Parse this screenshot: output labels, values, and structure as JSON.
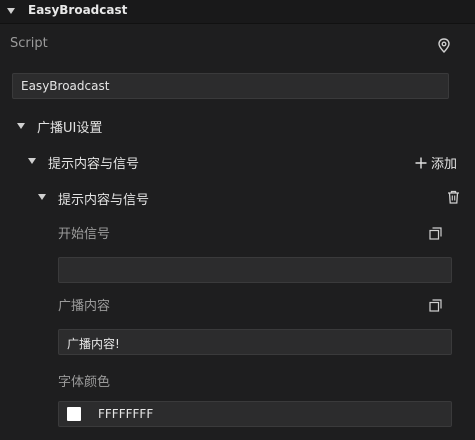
{
  "component": {
    "title": "EasyBroadcast"
  },
  "script": {
    "label": "Script",
    "value": "EasyBroadcast",
    "locate_icon": "location-pin-icon"
  },
  "broadcast_ui": {
    "label": "广播UI设置"
  },
  "prompt_group": {
    "label": "提示内容与信号",
    "add_label": "添加",
    "add_icon": "plus-icon"
  },
  "prompt_item": {
    "label": "提示内容与信号",
    "delete_icon": "trash-icon",
    "start_signal": {
      "label": "开始信号",
      "value": ""
    },
    "broadcast_content": {
      "label": "广播内容",
      "value": "广播内容!"
    },
    "font_color": {
      "label": "字体颜色",
      "value": "FFFFFFFF",
      "swatch": "#FFFFFF"
    }
  },
  "colors": {
    "panel_bg": "#1E1E1F",
    "field_bg": "#2C2C2D",
    "text": "#E2E2E2"
  }
}
